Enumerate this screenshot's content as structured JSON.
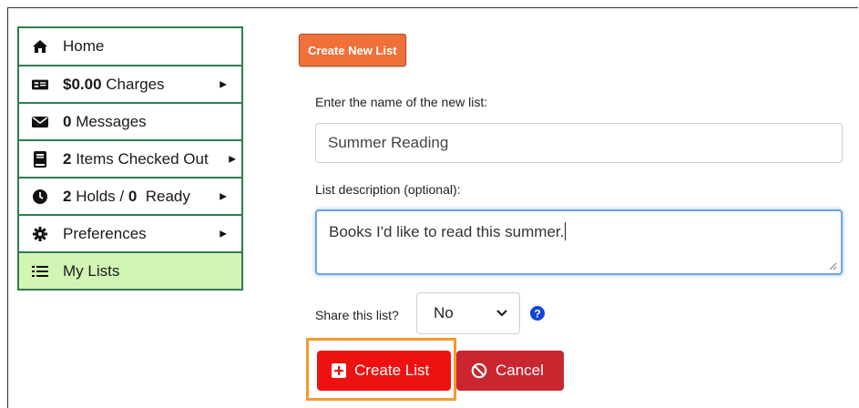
{
  "sidebar": {
    "items": [
      {
        "icon": "home-icon",
        "bold": "",
        "label": "Home",
        "caret": false
      },
      {
        "icon": "money-card-icon",
        "bold": "$0.00",
        "label": " Charges",
        "caret": true
      },
      {
        "icon": "envelope-icon",
        "bold": "0",
        "label": " Messages",
        "caret": false
      },
      {
        "icon": "book-icon",
        "bold": "2",
        "label": " Items Checked Out",
        "caret": true
      },
      {
        "icon": "clock-icon",
        "bold": "2",
        "label": " Holds / ",
        "bold2": "0",
        "label2": "  Ready",
        "caret": true
      },
      {
        "icon": "gear-icon",
        "bold": "",
        "label": "Preferences",
        "caret": true
      },
      {
        "icon": "list-icon",
        "bold": "",
        "label": "My Lists",
        "caret": false,
        "active": true
      }
    ]
  },
  "main": {
    "create_new_label": "Create New List",
    "name_label": "Enter the name of the new list:",
    "name_value": "Summer Reading",
    "desc_label": "List description (optional):",
    "desc_value": "Books I'd like to read this summer.",
    "share_label": "Share this list?",
    "share_value": "No",
    "create_button": "Create List",
    "cancel_button": "Cancel"
  },
  "colors": {
    "nav_border": "#2e7d4f",
    "active_bg": "#d3f5b4",
    "create_new_bg": "#f0703a",
    "create_btn": "#ee1111",
    "cancel_btn": "#c9262f",
    "highlight": "#f39a2e",
    "focus": "#6ba4e6",
    "help": "#1344d8"
  }
}
